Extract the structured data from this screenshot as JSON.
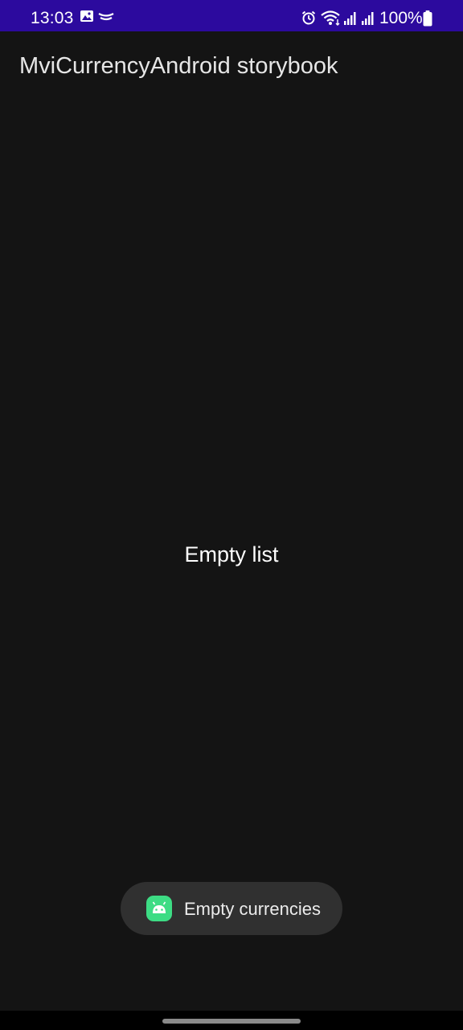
{
  "status_bar": {
    "time": "13:03",
    "battery": "100%",
    "background_color": "#2c0a9e",
    "icons": [
      "gallery-icon",
      "cast-icon",
      "alarm-icon",
      "wifi-icon",
      "signal-icon",
      "signal-icon",
      "battery-icon"
    ]
  },
  "app_bar": {
    "title": "MviCurrencyAndroid storybook"
  },
  "content": {
    "empty_message": "Empty list"
  },
  "toast": {
    "message": "Empty currencies",
    "icon": "android-app-icon",
    "icon_color": "#3ddc84"
  },
  "colors": {
    "background": "#141414"
  }
}
